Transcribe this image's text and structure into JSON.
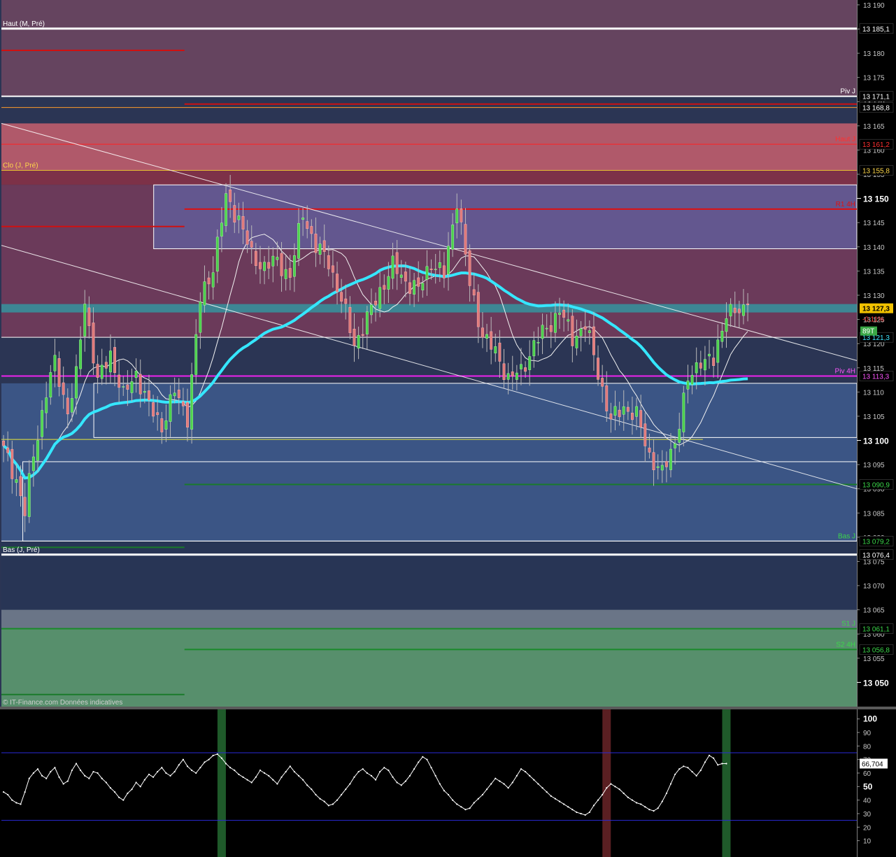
{
  "watermark": "© IT-Finance.com  Données indicatives",
  "price_panel": {
    "y_range": [
      13045,
      13191
    ],
    "major_ticks": [
      "13 050",
      "13 100",
      "13 150"
    ],
    "minor_ticks": [
      "13 055",
      "13 060",
      "13 065",
      "13 070",
      "13 075",
      "13 080",
      "13 085",
      "13 090",
      "13 095",
      "13 105",
      "13 110",
      "13 115",
      "13 120",
      "13 125",
      "13 130",
      "13 135",
      "13 140",
      "13 145",
      "13 155",
      "13 160",
      "13 165",
      "13 170",
      "13 175",
      "13 180",
      "13 185",
      "13 190"
    ],
    "zones": [
      {
        "from": 13171.1,
        "to": 13191,
        "color": "#65445f"
      },
      {
        "from": 13155.8,
        "to": 13165.5,
        "color": "#b0596a"
      },
      {
        "from": 13152.8,
        "to": 13155.8,
        "color": "#7d3148"
      },
      {
        "from": 13121.3,
        "to": 13152.8,
        "color": "#6b3a5a"
      },
      {
        "from": 13111.8,
        "to": 13121.3,
        "color": "#2b3554"
      },
      {
        "from": 13079.2,
        "to": 13111.8,
        "color": "#3b5585"
      },
      {
        "from": 13065.0,
        "to": 13079.2,
        "color": "#283555"
      },
      {
        "from": 13061.1,
        "to": 13065.0,
        "color": "#6a7587"
      },
      {
        "from": 13045,
        "to": 13061.1,
        "color": "#578f6c"
      }
    ],
    "boxes": [
      {
        "x0": 0.178,
        "x1": 1.0,
        "top": 13152.8,
        "bottom": 13139.6,
        "fill": "#63578f"
      },
      {
        "x0": 0.108,
        "x1": 1.0,
        "top": 13111.8,
        "bottom": 13100.6,
        "fill": "none"
      },
      {
        "x0": 0.025,
        "x1": 1.0,
        "top": 13095.6,
        "bottom": 13079.2,
        "fill": "none"
      }
    ],
    "levels": [
      {
        "label": "Haut (M, Pré)",
        "value": 13185.1,
        "color": "#ffffff",
        "width": 3,
        "tag": "13 185,1",
        "tag_fg": "#ffffff",
        "label_side": "left",
        "x0": 0
      },
      {
        "label": "",
        "value": 13180.6,
        "color": "#d01010",
        "width": 2,
        "tag": "",
        "x0": 0,
        "x1": 0.214
      },
      {
        "label": "Piv J",
        "value": 13171.1,
        "color": "#ffffff",
        "width": 2,
        "tag": "13 171,1",
        "tag_fg": "#ffffff",
        "label_side": "right",
        "x0": 0
      },
      {
        "label": "",
        "value": 13169.5,
        "color": "#d01010",
        "width": 2,
        "tag": "",
        "x0": 0.214
      },
      {
        "label": "",
        "value": 13168.8,
        "color": "#ff9a2a",
        "width": 1,
        "tag": "13 168,8",
        "tag_fg": "#ffffff",
        "label_side": "right",
        "x0": 0
      },
      {
        "label": "Haut J",
        "value": 13161.2,
        "color": "#ff2020",
        "width": 1,
        "tag": "13 161,2",
        "tag_fg": "#ff3030",
        "label_side": "right",
        "x0": 0
      },
      {
        "label": "Clo (J, Pré)",
        "value": 13155.8,
        "color": "#e8c030",
        "width": 1,
        "tag": "13 155,8",
        "tag_fg": "#ffd84a",
        "label_side": "left",
        "x0": 0
      },
      {
        "label": "R1 4H",
        "value": 13147.8,
        "color": "#e01010",
        "width": 2,
        "tag": "",
        "label_side": "right",
        "x0": 0.214
      },
      {
        "label": "",
        "value": 13144.2,
        "color": "#d01010",
        "width": 2,
        "tag": "",
        "x0": 0,
        "x1": 0.214
      },
      {
        "label": "",
        "value": 13127.3,
        "color": "#2ea0a8",
        "width": 12,
        "tag": "",
        "x0": 0
      },
      {
        "label": "",
        "value": 13121.3,
        "color": "#ffffff",
        "width": 1,
        "tag": "13 121,3",
        "tag_fg": "#3fe6ff",
        "label_side": "right",
        "x0": 0
      },
      {
        "label": "Piv 4H",
        "value": 13113.3,
        "color": "#ee22ee",
        "width": 2,
        "tag": "13 113,3",
        "tag_fg": "#ff55ff",
        "label_side": "right",
        "x0": 0
      },
      {
        "label": "",
        "value": 13100.2,
        "color": "#e8e838",
        "width": 1,
        "tag": "",
        "x0": 0,
        "x1": 0.82
      },
      {
        "label": "",
        "value": 13090.9,
        "color": "#1a7a2a",
        "width": 2,
        "tag": "13 090,9",
        "tag_fg": "#3bd84a",
        "label_side": "right",
        "x0": 0.214
      },
      {
        "label": "Bas J",
        "value": 13079.2,
        "color": "#ffffff",
        "width": 1,
        "tag": "13 079,2",
        "tag_fg": "#3bd84a",
        "label_side": "right",
        "x0": 0
      },
      {
        "label": "",
        "value": 13077.9,
        "color": "#1a7a2a",
        "width": 2,
        "tag": "",
        "x0": 0,
        "x1": 0.214
      },
      {
        "label": "Bas (J, Pré)",
        "value": 13076.4,
        "color": "#ffffff",
        "width": 3,
        "tag": "13 076,4",
        "tag_fg": "#ffffff",
        "label_side": "left",
        "x0": 0
      },
      {
        "label": "S1 J",
        "value": 13061.1,
        "color": "#1a8a2a",
        "width": 2,
        "tag": "13 061,1",
        "tag_fg": "#3bd84a",
        "label_side": "right",
        "x0": 0
      },
      {
        "label": "S2 4H",
        "value": 13056.8,
        "color": "#1a8a2a",
        "width": 2,
        "tag": "13 056,8",
        "tag_fg": "#3bd84a",
        "label_side": "right",
        "x0": 0.214
      },
      {
        "label": "",
        "value": 13047.5,
        "color": "#1a7a2a",
        "width": 2,
        "tag": "",
        "x0": 0,
        "x1": 0.214
      }
    ],
    "trendlines": [
      {
        "x": [
          0.0,
          1.0
        ],
        "y": [
          13165.5,
          13116.5
        ],
        "color": "#ffffff",
        "width": 1
      },
      {
        "x": [
          0.0,
          1.0
        ],
        "y": [
          13140.3,
          13090.0
        ],
        "color": "#ffffff",
        "width": 1
      }
    ],
    "last_price_tag": "13 127,3",
    "change_tag": "-0,11%",
    "volume_tag": "89T"
  },
  "chart_data": [
    {
      "type": "candlestick",
      "title": "",
      "xlabel": "",
      "ylabel": "",
      "ylim": [
        13045,
        13191
      ],
      "grid": false,
      "candles_count": 200,
      "anchor_closes": [
        {
          "i": 0,
          "c": 13098
        },
        {
          "i": 3,
          "c": 13092
        },
        {
          "i": 5,
          "c": 13085
        },
        {
          "i": 7,
          "c": 13097
        },
        {
          "i": 10,
          "c": 13110
        },
        {
          "i": 12,
          "c": 13116
        },
        {
          "i": 15,
          "c": 13106
        },
        {
          "i": 17,
          "c": 13113
        },
        {
          "i": 19,
          "c": 13129
        },
        {
          "i": 22,
          "c": 13112
        },
        {
          "i": 25,
          "c": 13118
        },
        {
          "i": 28,
          "c": 13109
        },
        {
          "i": 31,
          "c": 13114
        },
        {
          "i": 34,
          "c": 13107
        },
        {
          "i": 37,
          "c": 13103
        },
        {
          "i": 40,
          "c": 13110
        },
        {
          "i": 43,
          "c": 13105
        },
        {
          "i": 46,
          "c": 13129
        },
        {
          "i": 49,
          "c": 13136
        },
        {
          "i": 52,
          "c": 13150
        },
        {
          "i": 55,
          "c": 13146
        },
        {
          "i": 58,
          "c": 13138
        },
        {
          "i": 61,
          "c": 13136
        },
        {
          "i": 64,
          "c": 13137
        },
        {
          "i": 67,
          "c": 13134
        },
        {
          "i": 70,
          "c": 13147
        },
        {
          "i": 73,
          "c": 13140
        },
        {
          "i": 76,
          "c": 13137
        },
        {
          "i": 79,
          "c": 13129
        },
        {
          "i": 82,
          "c": 13120
        },
        {
          "i": 85,
          "c": 13125
        },
        {
          "i": 88,
          "c": 13131
        },
        {
          "i": 91,
          "c": 13136
        },
        {
          "i": 94,
          "c": 13133
        },
        {
          "i": 97,
          "c": 13131
        },
        {
          "i": 100,
          "c": 13137
        },
        {
          "i": 103,
          "c": 13134
        },
        {
          "i": 106,
          "c": 13150
        },
        {
          "i": 109,
          "c": 13132
        },
        {
          "i": 112,
          "c": 13122
        },
        {
          "i": 115,
          "c": 13118
        },
        {
          "i": 118,
          "c": 13113
        },
        {
          "i": 121,
          "c": 13114
        },
        {
          "i": 124,
          "c": 13120
        },
        {
          "i": 127,
          "c": 13123
        },
        {
          "i": 130,
          "c": 13127
        },
        {
          "i": 133,
          "c": 13121
        },
        {
          "i": 136,
          "c": 13124
        },
        {
          "i": 139,
          "c": 13114
        },
        {
          "i": 142,
          "c": 13104
        },
        {
          "i": 145,
          "c": 13107
        },
        {
          "i": 148,
          "c": 13105
        },
        {
          "i": 151,
          "c": 13097
        },
        {
          "i": 154,
          "c": 13093
        },
        {
          "i": 157,
          "c": 13100
        },
        {
          "i": 160,
          "c": 13112
        },
        {
          "i": 163,
          "c": 13117
        },
        {
          "i": 166,
          "c": 13116
        },
        {
          "i": 169,
          "c": 13127
        },
        {
          "i": 172,
          "c": 13126
        },
        {
          "i": 174,
          "c": 13128
        }
      ]
    },
    {
      "type": "line",
      "title": "",
      "ylim": [
        0,
        105
      ],
      "ticks": [
        "10",
        "20",
        "30",
        "40",
        "50",
        "60",
        "70",
        "80",
        "90",
        "100"
      ],
      "bands": [
        25,
        75
      ],
      "last_value_tag": "66,704",
      "highlights": [
        {
          "i": 51,
          "color": "#1f5a2a"
        },
        {
          "i": 141,
          "color": "#5a1f22"
        },
        {
          "i": 169,
          "color": "#1f5a2a"
        }
      ],
      "series": [
        {
          "values": [
            46,
            44,
            40,
            38,
            37,
            46,
            56,
            60,
            63,
            58,
            56,
            61,
            64,
            57,
            52,
            54,
            62,
            67,
            62,
            58,
            56,
            61,
            60,
            56,
            53,
            49,
            46,
            42,
            40,
            45,
            48,
            53,
            50,
            55,
            59,
            57,
            61,
            64,
            60,
            58,
            61,
            66,
            70,
            65,
            62,
            60,
            64,
            68,
            70,
            73,
            74,
            71,
            67,
            64,
            62,
            59,
            57,
            55,
            53,
            57,
            62,
            60,
            58,
            55,
            52,
            57,
            61,
            65,
            61,
            58,
            55,
            51,
            48,
            44,
            41,
            39,
            36,
            37,
            40,
            44,
            48,
            52,
            57,
            61,
            63,
            60,
            58,
            55,
            61,
            64,
            62,
            57,
            53,
            51,
            54,
            58,
            63,
            68,
            72,
            70,
            64,
            58,
            52,
            47,
            44,
            40,
            37,
            35,
            33,
            34,
            38,
            41,
            44,
            48,
            52,
            56,
            54,
            52,
            49,
            53,
            58,
            63,
            61,
            58,
            55,
            52,
            49,
            46,
            43,
            41,
            39,
            37,
            35,
            33,
            31,
            30,
            29,
            31,
            36,
            40,
            44,
            49,
            52,
            50,
            48,
            45,
            42,
            40,
            38,
            37,
            35,
            33,
            32,
            34,
            39,
            45,
            52,
            59,
            63,
            65,
            64,
            61,
            58,
            62,
            68,
            73,
            71,
            66,
            67,
            67
          ]
        }
      ]
    }
  ]
}
